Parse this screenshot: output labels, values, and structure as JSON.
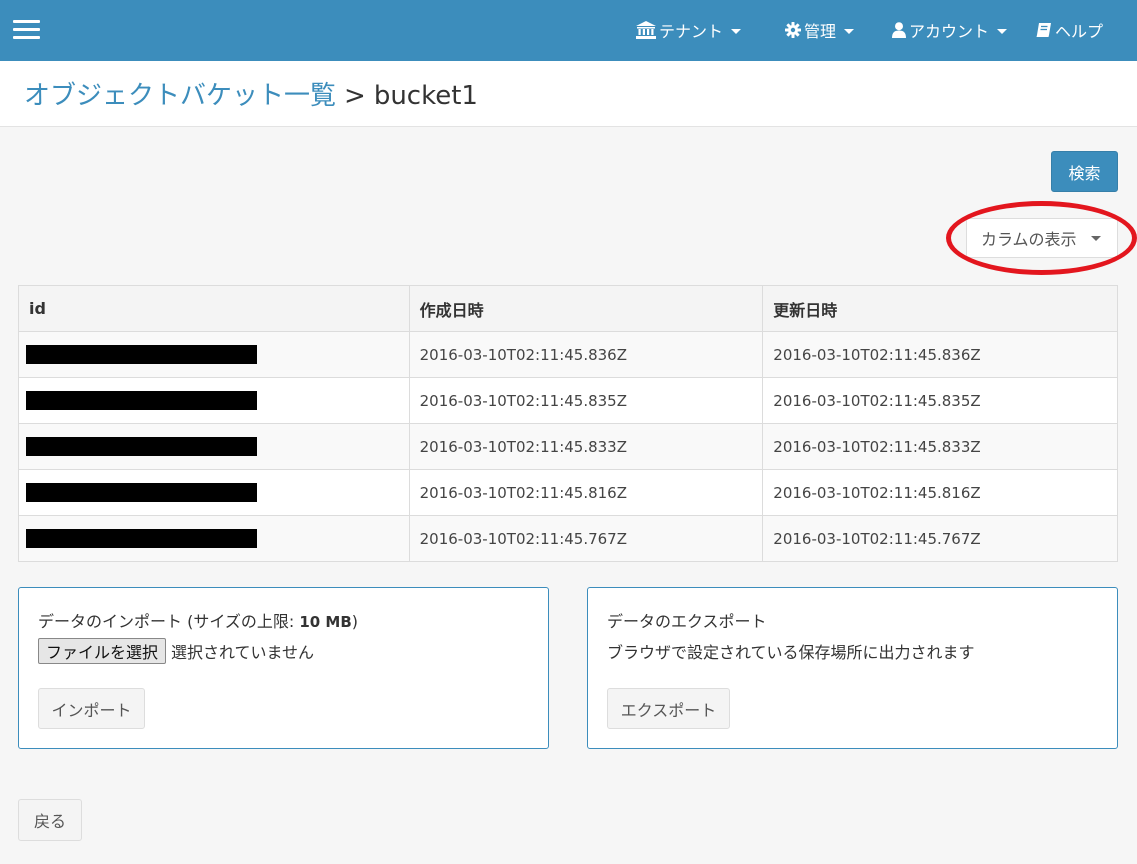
{
  "navbar": {
    "tenant_label": "テナント",
    "admin_label": "管理",
    "account_label": "アカウント",
    "help_label": "ヘルプ"
  },
  "breadcrumb": {
    "parent": "オブジェクトバケット一覧",
    "separator": ">",
    "current": "bucket1"
  },
  "toolbar": {
    "search_label": "検索",
    "columns_label": "カラムの表示"
  },
  "table": {
    "headers": [
      "id",
      "作成日時",
      "更新日時"
    ],
    "rows": [
      {
        "created": "2016-03-10T02:11:45.836Z",
        "updated": "2016-03-10T02:11:45.836Z"
      },
      {
        "created": "2016-03-10T02:11:45.835Z",
        "updated": "2016-03-10T02:11:45.835Z"
      },
      {
        "created": "2016-03-10T02:11:45.833Z",
        "updated": "2016-03-10T02:11:45.833Z"
      },
      {
        "created": "2016-03-10T02:11:45.816Z",
        "updated": "2016-03-10T02:11:45.816Z"
      },
      {
        "created": "2016-03-10T02:11:45.767Z",
        "updated": "2016-03-10T02:11:45.767Z"
      }
    ]
  },
  "import_box": {
    "title": "データのインポート (サイズの上限: ",
    "limit": "10 MB",
    "title_suffix": ")",
    "file_button": "ファイルを選択",
    "file_status": "選択されていません",
    "button_label": "インポート"
  },
  "export_box": {
    "title": "データのエクスポート",
    "description": "ブラウザで設定されている保存場所に出力されます",
    "button_label": "エクスポート"
  },
  "back_label": "戻る",
  "colors": {
    "primary": "#3c8dbc",
    "annotation": "#e3161e"
  }
}
